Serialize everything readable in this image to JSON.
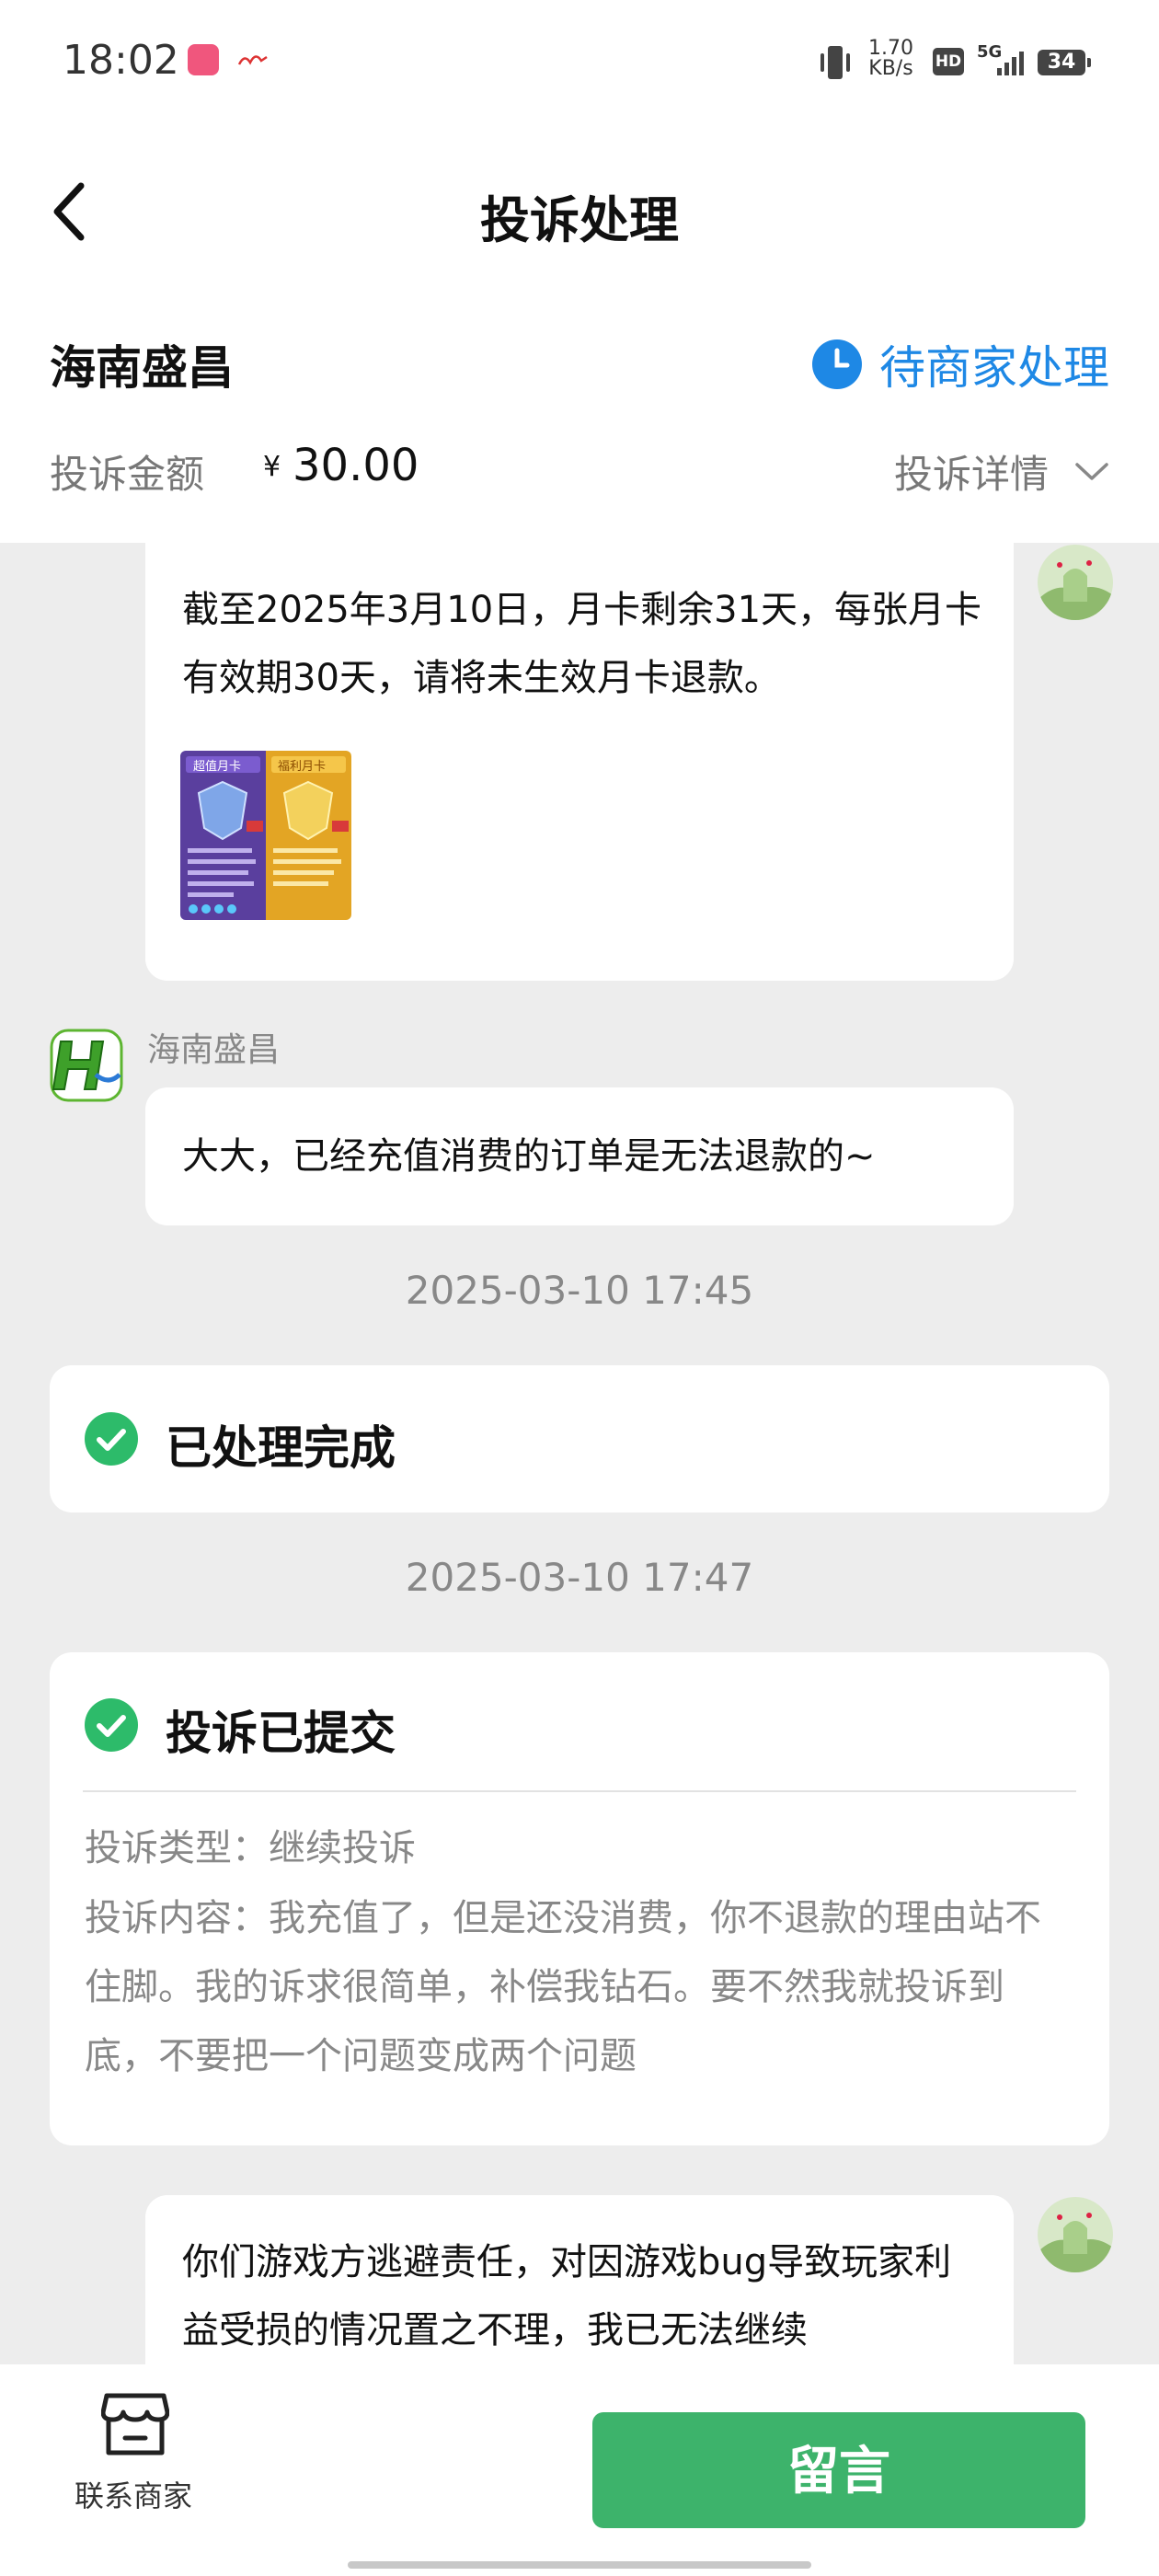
{
  "status_bar": {
    "time": "18:02",
    "net_speed_value": "1.70",
    "net_speed_unit": "KB/s",
    "hd_badge": "HD",
    "network": "5G",
    "battery": "34"
  },
  "nav": {
    "title": "投诉处理",
    "back_icon": "chevron-left-icon"
  },
  "header": {
    "merchant": "海南盛昌",
    "status": "待商家处理",
    "status_color": "#1e88e5",
    "amount_label": "投诉金额",
    "amount_symbol": "¥",
    "amount_value": "30.00",
    "detail_label": "投诉详情"
  },
  "messages": {
    "user1": {
      "text": "截至2025年3月10日，月卡剩余31天，每张月卡有效期30天，请将未生效月卡退款。",
      "thumb_left_caption": "超值月卡",
      "thumb_right_caption": "福利月卡"
    },
    "merchant": {
      "sender": "海南盛昌",
      "text": "大大，已经充值消费的订单是无法退款的~"
    },
    "ts1": "2025-03-10 17:45",
    "card_done": {
      "title": "已处理完成"
    },
    "ts2": "2025-03-10 17:47",
    "card_submitted": {
      "title": "投诉已提交",
      "type_line": "投诉类型：继续投诉",
      "content_line": "投诉内容：我充值了，但是还没消费，你不退款的理由站不住脚。我的诉求很简单，补偿我钻石。要不然我就投诉到底，不要把一个问题变成两个问题"
    },
    "user2": {
      "text": "你们游戏方逃避责任，对因游戏bug导致玩家利益受损的情况置之不理，我已无法继续"
    }
  },
  "bottom": {
    "contact_label": "联系商家",
    "leave_message": "留言",
    "accent": "#3db36b"
  }
}
